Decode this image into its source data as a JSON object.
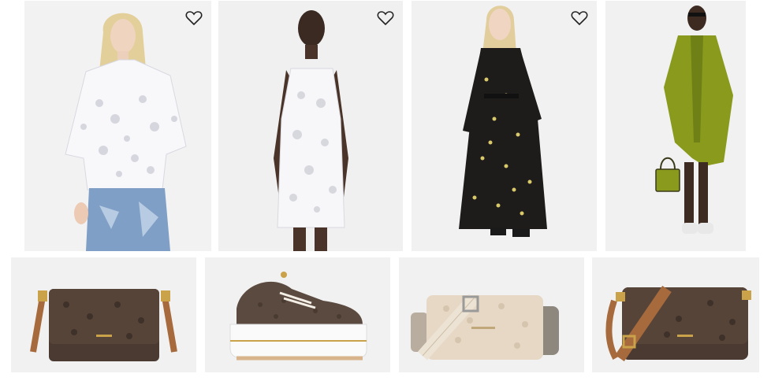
{
  "grid": {
    "top_row": [
      {
        "kind": "lace-shirt",
        "wishlist_icon": "heart-outline-icon"
      },
      {
        "kind": "lace-mini-dress",
        "wishlist_icon": "heart-outline-icon"
      },
      {
        "kind": "floral-maxi-dress",
        "wishlist_icon": "heart-outline-icon"
      },
      {
        "kind": "olive-bomber-coat"
      }
    ],
    "bottom_row": [
      {
        "kind": "logo-crossbody-bag"
      },
      {
        "kind": "logo-platform-sneaker"
      },
      {
        "kind": "jacquard-logo-bag"
      },
      {
        "kind": "logo-shoulder-bag"
      }
    ]
  },
  "colors": {
    "tile_background": "#f1f1f1",
    "logo_brown": "#4a3a32",
    "leather_tan": "#a66a3c",
    "hardware_gold": "#c9a24a",
    "olive": "#8a9a1c",
    "cream_logo": "#e6d8c5"
  }
}
